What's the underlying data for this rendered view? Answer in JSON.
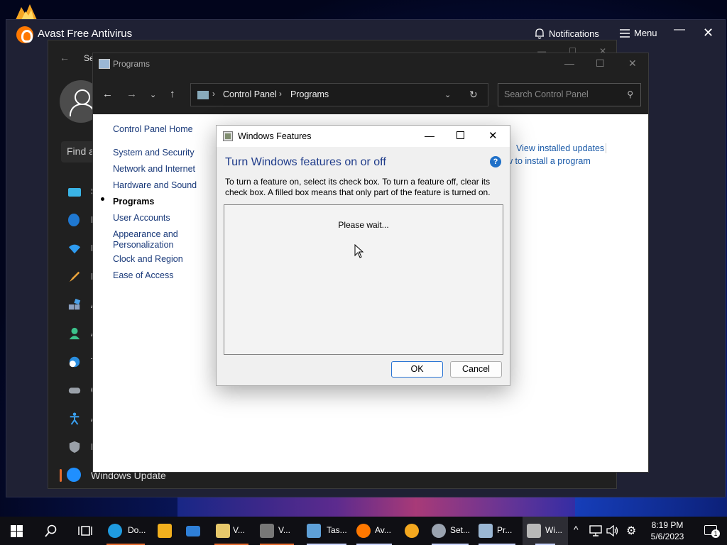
{
  "avast": {
    "title": "Avast Free Antivirus",
    "notifications": "Notifications",
    "menu": "Menu"
  },
  "settings": {
    "title_partial": "Se",
    "find": "Find a",
    "nav_letters": [
      "S",
      "B",
      "N",
      "P",
      "A",
      "A",
      "T",
      "G",
      "A",
      "P"
    ],
    "windows_update": "Windows Update"
  },
  "control_panel": {
    "title": "Programs",
    "breadcrumbs": [
      "Control Panel",
      "Programs"
    ],
    "search_placeholder": "Search Control Panel",
    "left_nav": [
      {
        "label": "Control Panel Home",
        "active": false
      },
      {
        "label": "System and Security",
        "active": false
      },
      {
        "label": "Network and Internet",
        "active": false
      },
      {
        "label": "Hardware and Sound",
        "active": false
      },
      {
        "label": "Programs",
        "active": true
      },
      {
        "label": "User Accounts",
        "active": false
      },
      {
        "label": "Appearance and Personalization",
        "active": false
      },
      {
        "label": "Clock and Region",
        "active": false
      },
      {
        "label": "Ease of Access",
        "active": false
      }
    ],
    "right_links": [
      "View installed updates",
      "w to install a program"
    ]
  },
  "dialog": {
    "title": "Windows Features",
    "heading": "Turn Windows features on or off",
    "help": "?",
    "description": "To turn a feature on, select its check box. To turn a feature off, clear its check box. A filled box means that only part of the feature is turned on.",
    "status": "Please wait...",
    "ok": "OK",
    "cancel": "Cancel"
  },
  "taskbar": {
    "items": [
      {
        "label": "Do...",
        "color": "#1f9be0"
      },
      {
        "label": "",
        "color": "#f2b01e"
      },
      {
        "label": "",
        "color": "#2f80d8"
      },
      {
        "label": "V...",
        "color": "#e7c86b"
      },
      {
        "label": "V...",
        "color": "#777777"
      },
      {
        "label": "Tas...",
        "color": "#5ea0d8"
      },
      {
        "label": "Av...",
        "color": "#ff7800"
      },
      {
        "label": "",
        "color": "#f4a81f"
      },
      {
        "label": "Set...",
        "color": "#9aa3b0"
      },
      {
        "label": "Pr...",
        "color": "#9bb7d4"
      },
      {
        "label": "Wi...",
        "color": "#b8b8b8"
      }
    ],
    "clock_time": "8:19 PM",
    "clock_date": "5/6/2023",
    "notification_count": "1"
  }
}
